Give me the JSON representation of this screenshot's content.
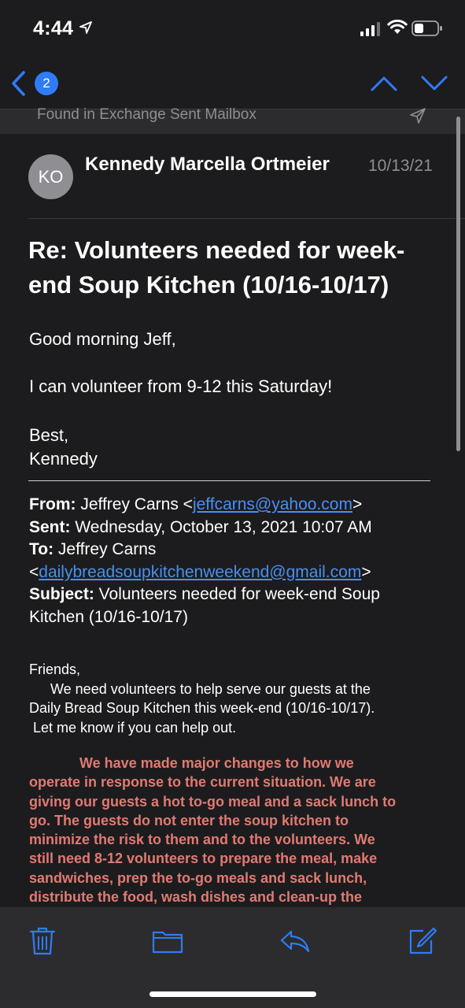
{
  "status_bar": {
    "time": "4:44"
  },
  "nav": {
    "badge_count": "2"
  },
  "found_banner": "Found in Exchange Sent Mailbox",
  "message": {
    "avatar_initials": "KO",
    "sender": "Kennedy Marcella Ortmeier",
    "date": "10/13/21",
    "subject": "Re: Volunteers needed for week-end Soup Kitchen (10/16-10/17)",
    "reply": {
      "greeting": "Good morning Jeff,",
      "line1": "I can volunteer from 9-12 this Saturday!",
      "signoff": "Best,",
      "signature": "Kennedy"
    },
    "quoted": {
      "from_label": "From:",
      "from_name": " Jeffrey Carns <",
      "from_email": "jeffcarns@yahoo.com",
      "from_close": ">",
      "sent_label": "Sent:",
      "sent_value": " Wednesday, October 13, 2021 10:07 AM",
      "to_label": "To:",
      "to_name": " Jeffrey Carns",
      "to_open": "<",
      "to_email": "dailybreadsoupkitchenweekend@gmail.com",
      "to_close": ">",
      "subject_label": "Subject:",
      "subject_value": " Volunteers needed for week-end Soup Kitchen (10/16-10/17)"
    },
    "body": {
      "salutation": "Friends,",
      "line1": "We need volunteers to help serve our guests at the",
      "line2": "Daily Bread Soup Kitchen this week-end (10/16-10/17).",
      "line3": "Let me know if you can help out.",
      "red_line1": "We have made major changes to how we",
      "red_line2": "operate in response to the current situation.   We are",
      "red_line3": "giving our guests a hot to-go meal and a sack lunch to",
      "red_line4": "go.   The guests do not enter the soup kitchen to",
      "red_line5": "minimize the risk to them and to the volunteers.    We",
      "red_line6": "still need 8-12 volunteers to prepare the meal, make",
      "red_line7": "sandwiches, prep the to-go meals and sack lunch,",
      "red_line8": "distribute the food, wash dishes and clean-up the"
    }
  },
  "colors": {
    "accent": "#2f7cf6",
    "link": "#4b8ff0",
    "warning_text": "#e07a72",
    "background": "#1c1c1e",
    "toolbar": "#2c2c2e"
  },
  "icons": {
    "status": [
      "location-arrow-icon",
      "signal-icon",
      "wifi-icon",
      "battery-icon"
    ],
    "nav": [
      "back-chevron-icon",
      "up-chevron-icon",
      "down-chevron-icon"
    ],
    "toolbar": [
      "trash-icon",
      "folder-icon",
      "reply-icon",
      "compose-icon"
    ]
  }
}
